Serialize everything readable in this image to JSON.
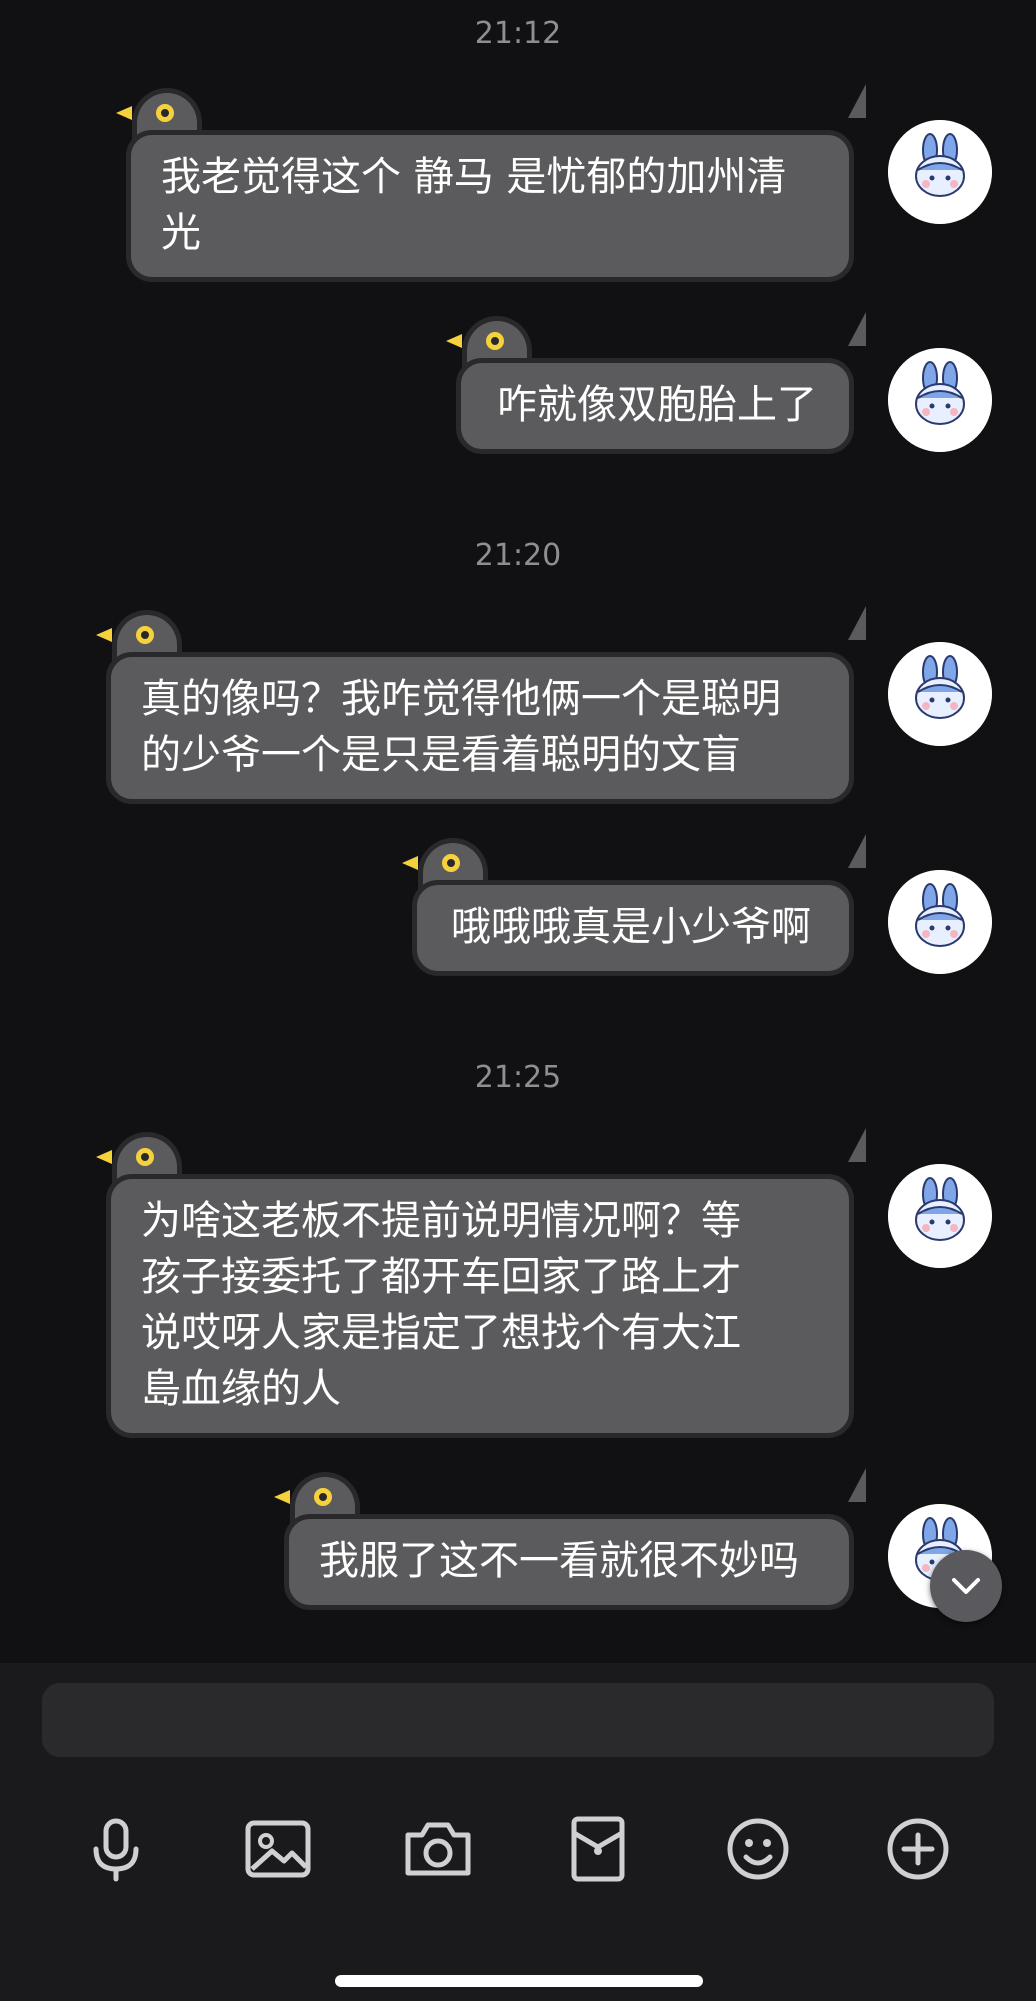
{
  "chat": {
    "timestamps": [
      "21:12",
      "21:20",
      "21:25"
    ],
    "messages": [
      {
        "line1": "我老觉得这个 静马 是忧郁的加州清",
        "line2": "光"
      },
      {
        "line1": "咋就像双胞胎上了"
      },
      {
        "line1": "真的像吗？我咋觉得他俩一个是聪明",
        "line2": "的少爷一个是只是看着聪明的文盲"
      },
      {
        "line1": "哦哦哦真是小少爷啊"
      },
      {
        "line1": "为啥这老板不提前说明情况啊？等",
        "line2": "孩子接委托了都开车回家了路上才",
        "line3": "说哎呀人家是指定了想找个有大江",
        "line4": "島血缘的人"
      },
      {
        "line1": "我服了这不一看就很不妙吗"
      }
    ]
  },
  "composer": {
    "value": "",
    "placeholder": ""
  },
  "colors": {
    "bubble": "#5b5b5d",
    "accent_eye": "#f5d23c",
    "background": "#111113"
  },
  "icons": [
    "microphone-icon",
    "image-icon",
    "camera-icon",
    "gift-pouch-icon",
    "emoji-icon",
    "plus-circle-icon",
    "chevron-down-icon"
  ]
}
